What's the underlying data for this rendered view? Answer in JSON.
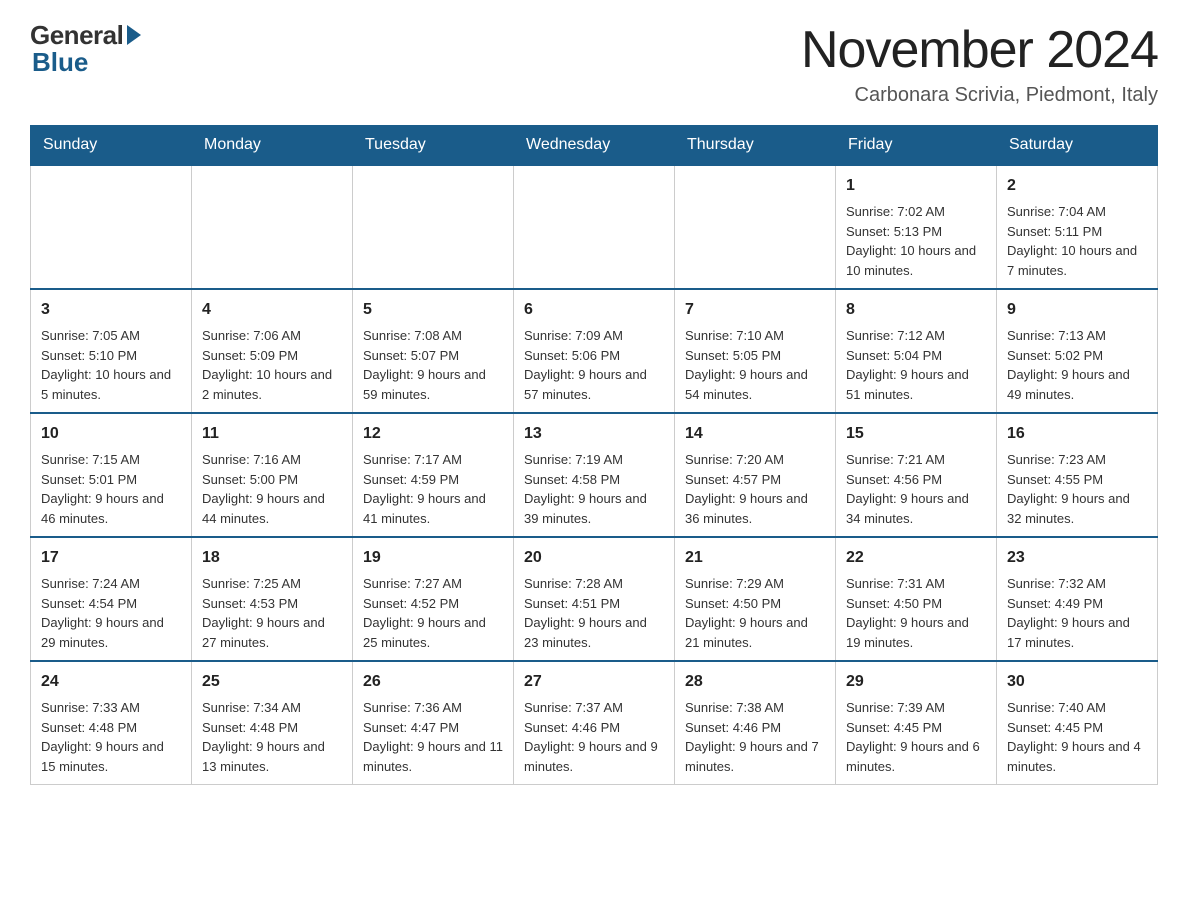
{
  "header": {
    "logo_general": "General",
    "logo_blue": "Blue",
    "month_title": "November 2024",
    "location": "Carbonara Scrivia, Piedmont, Italy"
  },
  "days_of_week": [
    "Sunday",
    "Monday",
    "Tuesday",
    "Wednesday",
    "Thursday",
    "Friday",
    "Saturday"
  ],
  "weeks": [
    [
      {
        "day": "",
        "info": ""
      },
      {
        "day": "",
        "info": ""
      },
      {
        "day": "",
        "info": ""
      },
      {
        "day": "",
        "info": ""
      },
      {
        "day": "",
        "info": ""
      },
      {
        "day": "1",
        "info": "Sunrise: 7:02 AM\nSunset: 5:13 PM\nDaylight: 10 hours and 10 minutes."
      },
      {
        "day": "2",
        "info": "Sunrise: 7:04 AM\nSunset: 5:11 PM\nDaylight: 10 hours and 7 minutes."
      }
    ],
    [
      {
        "day": "3",
        "info": "Sunrise: 7:05 AM\nSunset: 5:10 PM\nDaylight: 10 hours and 5 minutes."
      },
      {
        "day": "4",
        "info": "Sunrise: 7:06 AM\nSunset: 5:09 PM\nDaylight: 10 hours and 2 minutes."
      },
      {
        "day": "5",
        "info": "Sunrise: 7:08 AM\nSunset: 5:07 PM\nDaylight: 9 hours and 59 minutes."
      },
      {
        "day": "6",
        "info": "Sunrise: 7:09 AM\nSunset: 5:06 PM\nDaylight: 9 hours and 57 minutes."
      },
      {
        "day": "7",
        "info": "Sunrise: 7:10 AM\nSunset: 5:05 PM\nDaylight: 9 hours and 54 minutes."
      },
      {
        "day": "8",
        "info": "Sunrise: 7:12 AM\nSunset: 5:04 PM\nDaylight: 9 hours and 51 minutes."
      },
      {
        "day": "9",
        "info": "Sunrise: 7:13 AM\nSunset: 5:02 PM\nDaylight: 9 hours and 49 minutes."
      }
    ],
    [
      {
        "day": "10",
        "info": "Sunrise: 7:15 AM\nSunset: 5:01 PM\nDaylight: 9 hours and 46 minutes."
      },
      {
        "day": "11",
        "info": "Sunrise: 7:16 AM\nSunset: 5:00 PM\nDaylight: 9 hours and 44 minutes."
      },
      {
        "day": "12",
        "info": "Sunrise: 7:17 AM\nSunset: 4:59 PM\nDaylight: 9 hours and 41 minutes."
      },
      {
        "day": "13",
        "info": "Sunrise: 7:19 AM\nSunset: 4:58 PM\nDaylight: 9 hours and 39 minutes."
      },
      {
        "day": "14",
        "info": "Sunrise: 7:20 AM\nSunset: 4:57 PM\nDaylight: 9 hours and 36 minutes."
      },
      {
        "day": "15",
        "info": "Sunrise: 7:21 AM\nSunset: 4:56 PM\nDaylight: 9 hours and 34 minutes."
      },
      {
        "day": "16",
        "info": "Sunrise: 7:23 AM\nSunset: 4:55 PM\nDaylight: 9 hours and 32 minutes."
      }
    ],
    [
      {
        "day": "17",
        "info": "Sunrise: 7:24 AM\nSunset: 4:54 PM\nDaylight: 9 hours and 29 minutes."
      },
      {
        "day": "18",
        "info": "Sunrise: 7:25 AM\nSunset: 4:53 PM\nDaylight: 9 hours and 27 minutes."
      },
      {
        "day": "19",
        "info": "Sunrise: 7:27 AM\nSunset: 4:52 PM\nDaylight: 9 hours and 25 minutes."
      },
      {
        "day": "20",
        "info": "Sunrise: 7:28 AM\nSunset: 4:51 PM\nDaylight: 9 hours and 23 minutes."
      },
      {
        "day": "21",
        "info": "Sunrise: 7:29 AM\nSunset: 4:50 PM\nDaylight: 9 hours and 21 minutes."
      },
      {
        "day": "22",
        "info": "Sunrise: 7:31 AM\nSunset: 4:50 PM\nDaylight: 9 hours and 19 minutes."
      },
      {
        "day": "23",
        "info": "Sunrise: 7:32 AM\nSunset: 4:49 PM\nDaylight: 9 hours and 17 minutes."
      }
    ],
    [
      {
        "day": "24",
        "info": "Sunrise: 7:33 AM\nSunset: 4:48 PM\nDaylight: 9 hours and 15 minutes."
      },
      {
        "day": "25",
        "info": "Sunrise: 7:34 AM\nSunset: 4:48 PM\nDaylight: 9 hours and 13 minutes."
      },
      {
        "day": "26",
        "info": "Sunrise: 7:36 AM\nSunset: 4:47 PM\nDaylight: 9 hours and 11 minutes."
      },
      {
        "day": "27",
        "info": "Sunrise: 7:37 AM\nSunset: 4:46 PM\nDaylight: 9 hours and 9 minutes."
      },
      {
        "day": "28",
        "info": "Sunrise: 7:38 AM\nSunset: 4:46 PM\nDaylight: 9 hours and 7 minutes."
      },
      {
        "day": "29",
        "info": "Sunrise: 7:39 AM\nSunset: 4:45 PM\nDaylight: 9 hours and 6 minutes."
      },
      {
        "day": "30",
        "info": "Sunrise: 7:40 AM\nSunset: 4:45 PM\nDaylight: 9 hours and 4 minutes."
      }
    ]
  ]
}
